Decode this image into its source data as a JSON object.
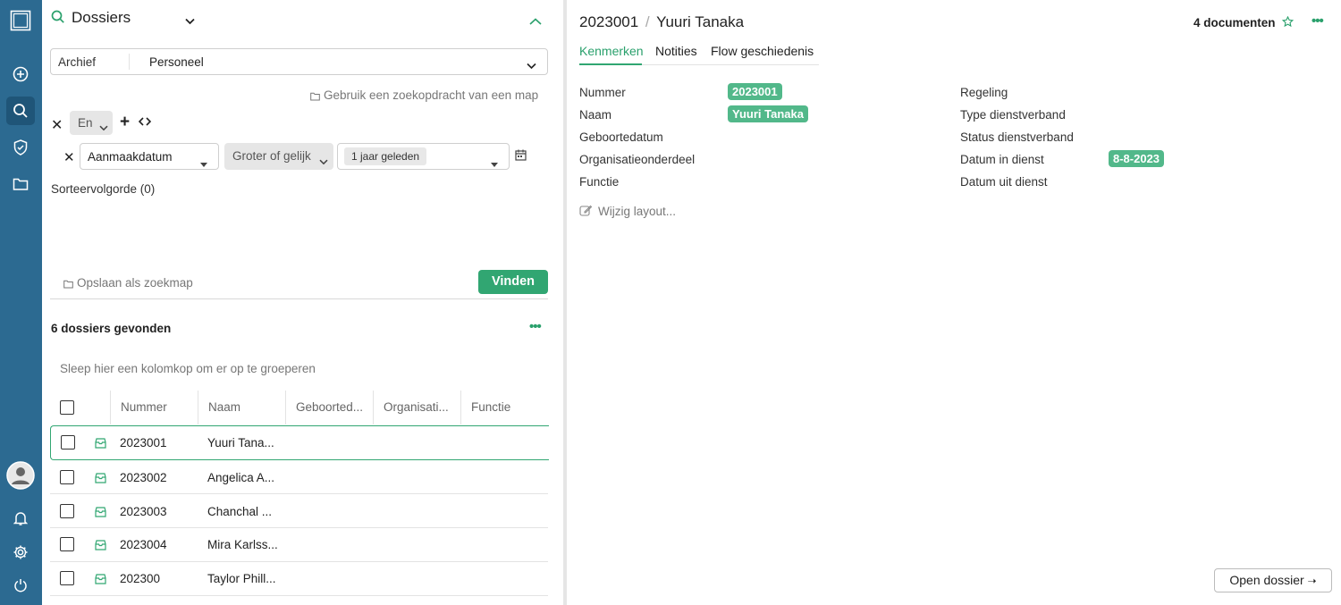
{
  "search": {
    "title": "Dossiers",
    "archive_label": "Archief",
    "archive_value": "Personeel",
    "use_query_link": "Gebruik een zoekopdracht van een map",
    "logic_operator": "En",
    "filter": {
      "field": "Aanmaakdatum",
      "operator": "Groter of gelijk",
      "value_tag": "1 jaar geleden"
    },
    "sort_order": "Sorteervolgorde (0)",
    "save_as_folder": "Opslaan als zoekmap",
    "find_button": "Vinden"
  },
  "results": {
    "count_label": "6 dossiers gevonden",
    "group_hint": "Sleep hier een kolomkop om er op te groeperen",
    "columns": [
      "Nummer",
      "Naam",
      "Geboorted...",
      "Organisati...",
      "Functie"
    ],
    "rows": [
      {
        "nummer": "2023001",
        "naam": "Yuuri Tana...",
        "selected": true
      },
      {
        "nummer": "2023002",
        "naam": "Angelica A...",
        "selected": false
      },
      {
        "nummer": "2023003",
        "naam": "Chanchal ...",
        "selected": false
      },
      {
        "nummer": "2023004",
        "naam": "Mira Karlss...",
        "selected": false
      },
      {
        "nummer": "202300",
        "naam": "Taylor Phill...",
        "selected": false
      }
    ]
  },
  "detail": {
    "number": "2023001",
    "separator": "/",
    "name": "Yuuri Tanaka",
    "documents": "4 documenten",
    "tabs": [
      "Kenmerken",
      "Notities",
      "Flow geschiedenis"
    ],
    "active_tab": 0,
    "fields_left": [
      {
        "label": "Nummer",
        "value": "2023001"
      },
      {
        "label": "Naam",
        "value": "Yuuri Tanaka"
      },
      {
        "label": "Geboortedatum",
        "value": ""
      },
      {
        "label": "Organisatieonderdeel",
        "value": ""
      },
      {
        "label": "Functie",
        "value": ""
      }
    ],
    "fields_right": [
      {
        "label": "Regeling",
        "value": ""
      },
      {
        "label": "Type dienstverband",
        "value": ""
      },
      {
        "label": "Status dienstverband",
        "value": ""
      },
      {
        "label": "Datum in dienst",
        "value": "8-8-2023"
      },
      {
        "label": "Datum uit dienst",
        "value": ""
      }
    ],
    "edit_layout": "Wijzig layout...",
    "open_button": "Open dossier",
    "open_arrow": "➝"
  },
  "colors": {
    "rail": "#2c6a91",
    "accent": "#31a672",
    "pill": "#52b88a"
  },
  "icons": [
    "app-logo-icon",
    "add-icon",
    "search-icon",
    "shield-icon",
    "folder-icon",
    "avatar-icon",
    "bell-icon",
    "gear-icon",
    "power-icon"
  ]
}
